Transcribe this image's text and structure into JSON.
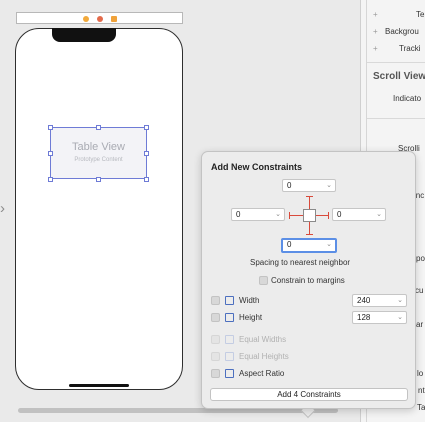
{
  "canvas": {
    "table_view": {
      "title": "Table View",
      "subtitle": "Prototype Content"
    },
    "scene_dot_colors": [
      "#f2a93b",
      "#e36a4a",
      "#f0a23a"
    ]
  },
  "inspector": {
    "rows": [
      "Te",
      "Backgrou",
      "Tracki",
      "Indicato",
      "Scrolli",
      "inc",
      "po",
      "cu",
      "ar",
      "lo",
      "nt",
      "Ta"
    ],
    "section_title": "Scroll View"
  },
  "popover": {
    "title": "Add New Constraints",
    "top_value": "0",
    "left_value": "0",
    "right_value": "0",
    "bottom_value": "0",
    "spacing_label": "Spacing to nearest neighbor",
    "constrain_margins_label": "Constrain to margins",
    "width": {
      "label": "Width",
      "value": "240"
    },
    "height": {
      "label": "Height",
      "value": "128"
    },
    "equal_widths_label": "Equal Widths",
    "equal_heights_label": "Equal Heights",
    "aspect_ratio_label": "Aspect Ratio",
    "add_button_label": "Add 4 Constraints",
    "accent_color": "#d94a3b",
    "focus_color": "#5c8fe6"
  }
}
